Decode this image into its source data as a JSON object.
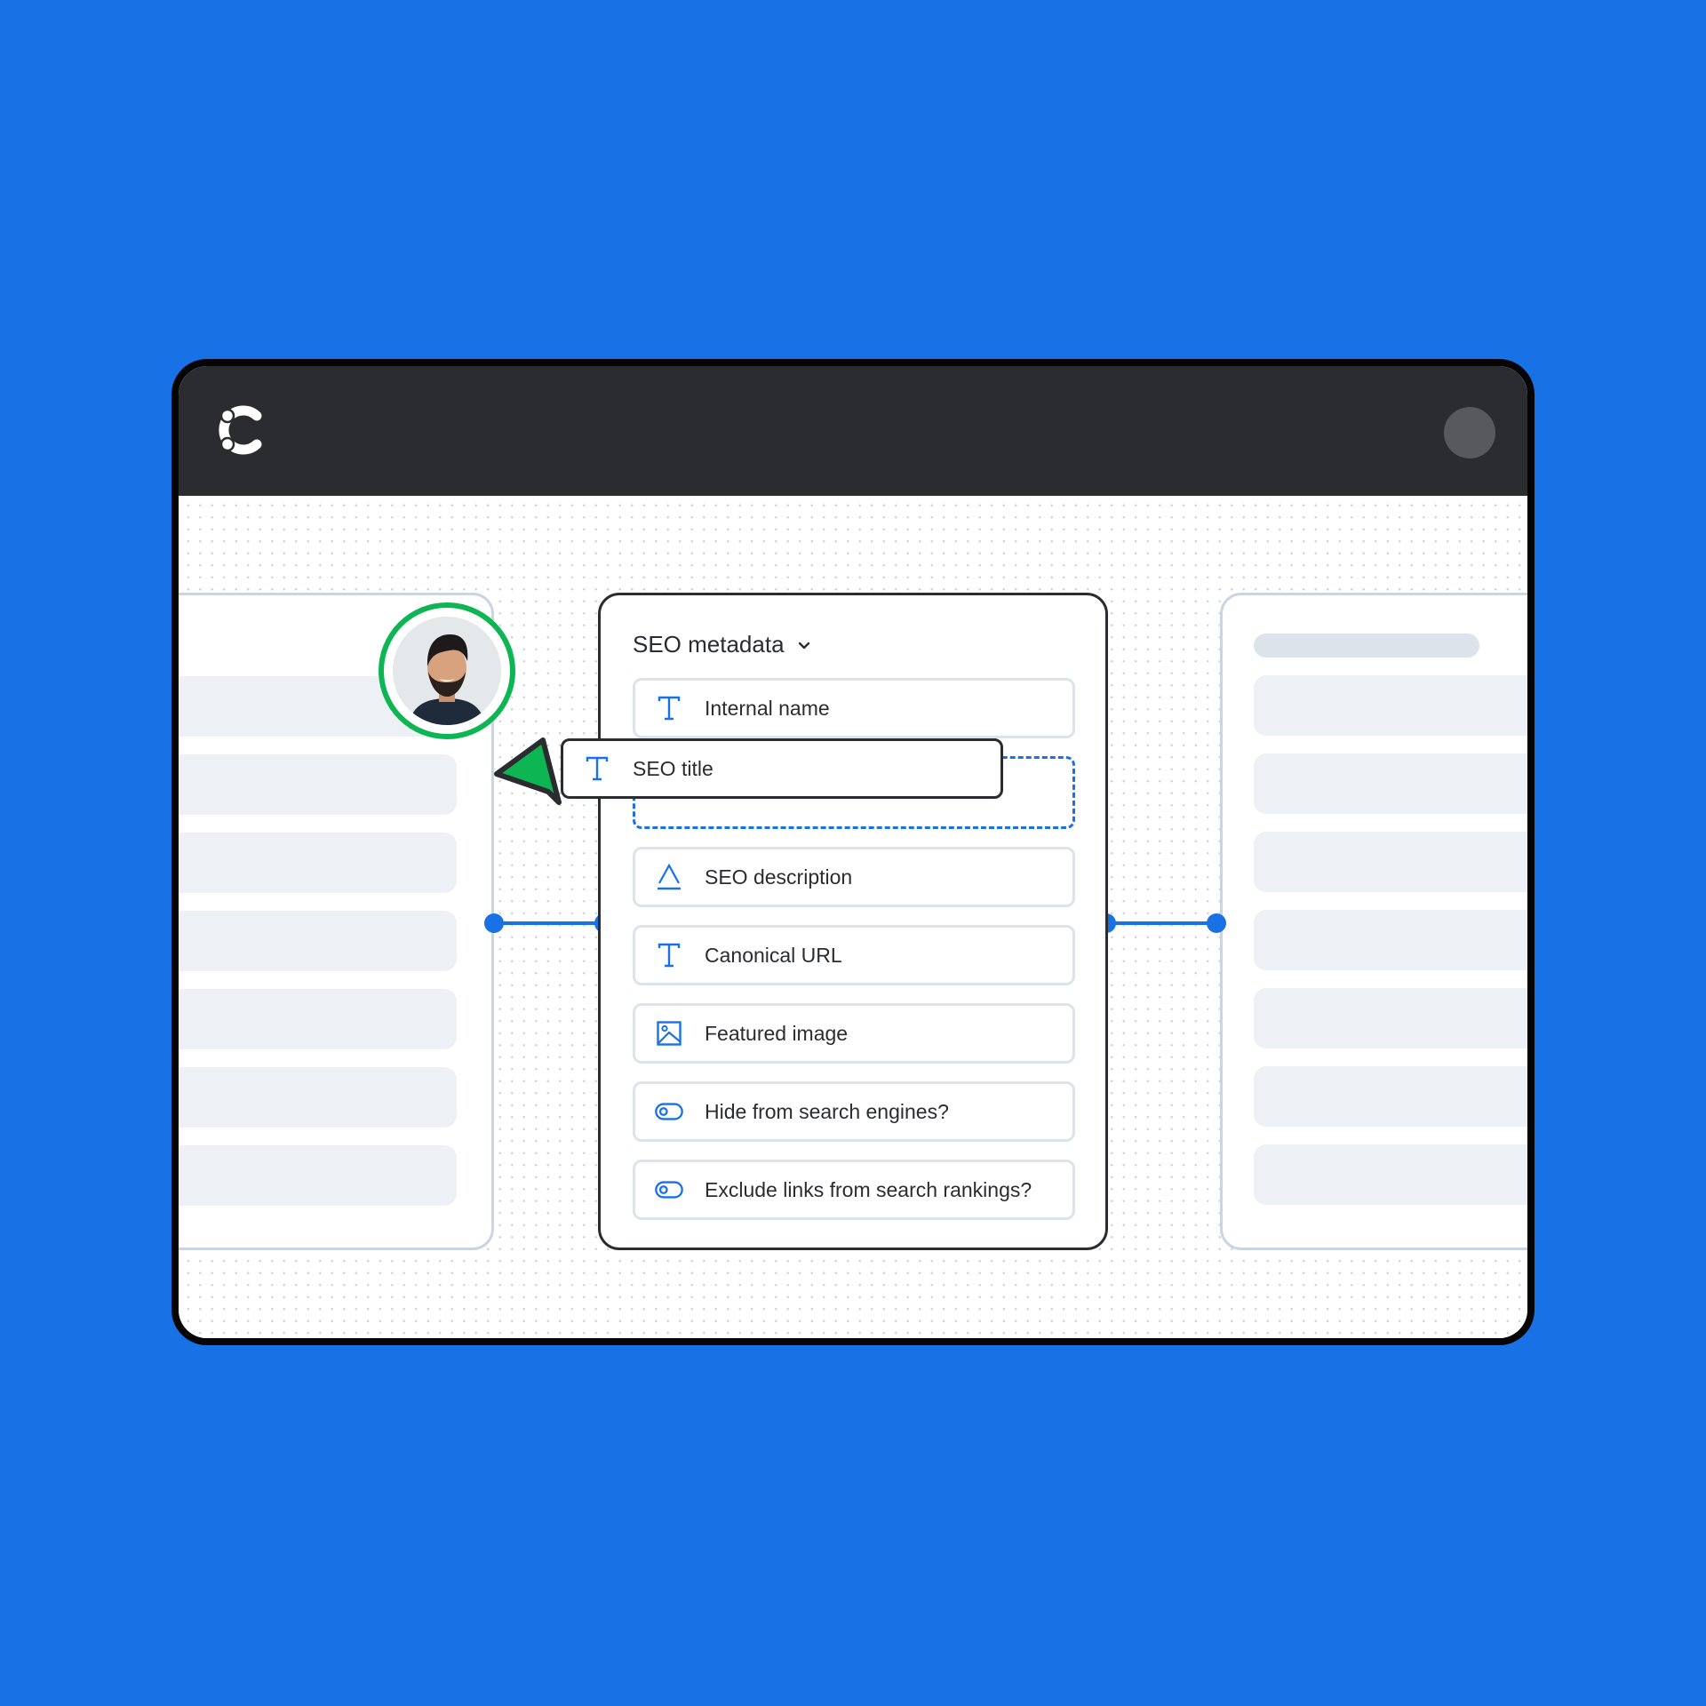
{
  "app": {
    "logo_icon": "contentful-logo-icon",
    "user_menu_icon": "user-avatar-placeholder-icon"
  },
  "colors": {
    "background": "#1971E6",
    "header": "#2B2C30",
    "accent": "#1971E6",
    "collaborator": "#0DB652",
    "field_border": "#DCE3EB",
    "panel_border": "#C9D5E2"
  },
  "content_type": {
    "title": "SEO metadata",
    "expand_icon": "chevron-down-icon",
    "fields": [
      {
        "label": "Internal name",
        "icon": "text-icon"
      },
      {
        "label": "SEO description",
        "icon": "rich-text-icon"
      },
      {
        "label": "Canonical URL",
        "icon": "text-icon"
      },
      {
        "label": "Featured image",
        "icon": "image-icon"
      },
      {
        "label": "Hide from search engines?",
        "icon": "toggle-icon"
      },
      {
        "label": "Exclude links from search rankings?",
        "icon": "toggle-icon"
      }
    ],
    "dragged_field": {
      "label": "SEO title",
      "icon": "text-icon"
    }
  },
  "collaborator": {
    "avatar_icon": "user-photo",
    "cursor_icon": "cursor-arrow-icon"
  }
}
